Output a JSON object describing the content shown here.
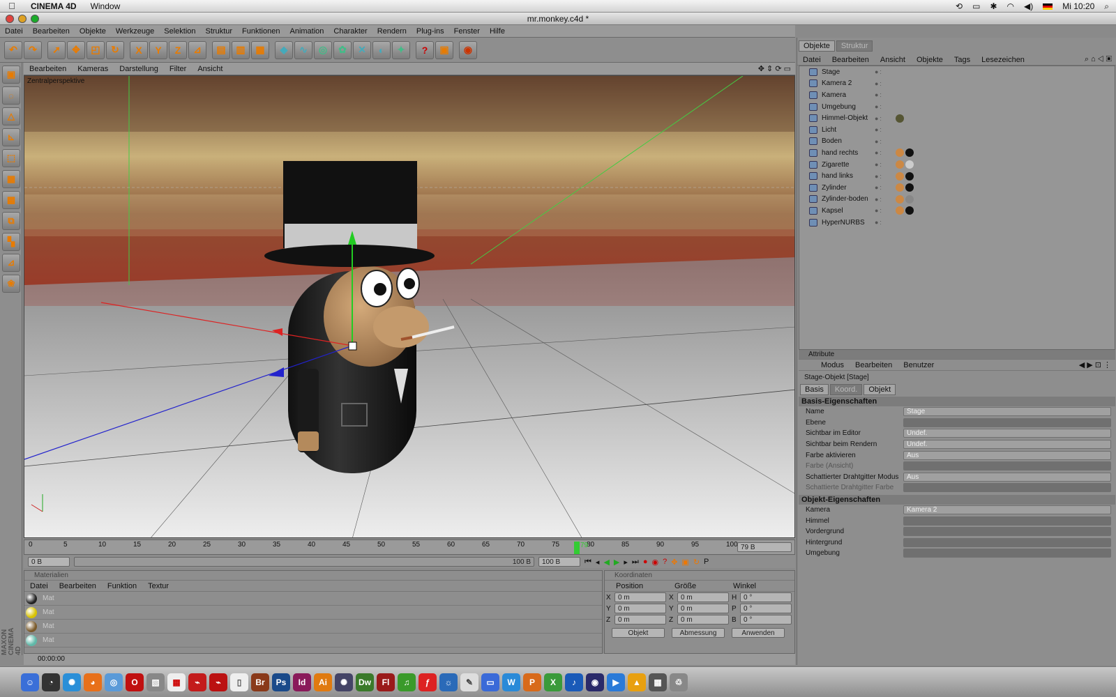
{
  "menubar": {
    "app": "CINEMA 4D",
    "window": "Window",
    "clock": "Mi 10:20"
  },
  "window": {
    "title": "mr.monkey.c4d *"
  },
  "main_menu": [
    "Datei",
    "Bearbeiten",
    "Objekte",
    "Werkzeuge",
    "Selektion",
    "Struktur",
    "Funktionen",
    "Animation",
    "Charakter",
    "Rendern",
    "Plug-ins",
    "Fenster",
    "Hilfe"
  ],
  "toolbar": {
    "axis_x": "X",
    "axis_y": "Y",
    "axis_z": "Z"
  },
  "viewport": {
    "menu": [
      "Bearbeiten",
      "Kameras",
      "Darstellung",
      "Filter",
      "Ansicht"
    ],
    "label": "Zentralperspektive"
  },
  "timeline": {
    "ticks": [
      "0",
      "5",
      "10",
      "15",
      "20",
      "25",
      "30",
      "35",
      "40",
      "45",
      "50",
      "55",
      "60",
      "65",
      "70",
      "75",
      "80",
      "85",
      "90",
      "95",
      "100"
    ],
    "current": "79",
    "current_field": "79 B",
    "start": "0 B",
    "range_end": "100 B",
    "end_field": "100 B"
  },
  "materials": {
    "title": "Materialien",
    "menu": [
      "Datei",
      "Bearbeiten",
      "Funktion",
      "Textur"
    ],
    "items": [
      {
        "name": "Mat",
        "color": "#222"
      },
      {
        "name": "Mat",
        "color": "#d8c200"
      },
      {
        "name": "Mat",
        "color": "#7a5a2a"
      },
      {
        "name": "Mat",
        "color": "#5fb8a8"
      }
    ]
  },
  "coords": {
    "title": "Koordinaten",
    "col_position": "Position",
    "col_size": "Größe",
    "col_angle": "Winkel",
    "rows": [
      {
        "a": "X",
        "p": "0 m",
        "b": "X",
        "s": "0 m",
        "c": "H",
        "w": "0 °"
      },
      {
        "a": "Y",
        "p": "0 m",
        "b": "Y",
        "s": "0 m",
        "c": "P",
        "w": "0 °"
      },
      {
        "a": "Z",
        "p": "0 m",
        "b": "Z",
        "s": "0 m",
        "c": "B",
        "w": "0 °"
      }
    ],
    "mode": "Objekt",
    "measure": "Abmessung",
    "apply": "Anwenden"
  },
  "status": {
    "time": "00:00:00"
  },
  "objects": {
    "tab_objects": "Objekte",
    "tab_structure": "Struktur",
    "menu": [
      "Datei",
      "Bearbeiten",
      "Ansicht",
      "Objekte",
      "Tags",
      "Lesezeichen"
    ],
    "items": [
      "Stage",
      "Kamera 2",
      "Kamera",
      "Umgebung",
      "Himmel-Objekt",
      "Licht",
      "Boden",
      "hand rechts",
      "Zigarette",
      "hand links",
      "Zylinder",
      "Zylinder-boden",
      "Kapsel",
      "HyperNURBS"
    ]
  },
  "attributes": {
    "title": "Attribute",
    "menu": [
      "Modus",
      "Bearbeiten",
      "Benutzer"
    ],
    "object": "Stage-Objekt [Stage]",
    "tabs": [
      "Basis",
      "Koord.",
      "Objekt"
    ],
    "basic_title": "Basis-Eigenschaften",
    "basic": [
      {
        "label": "Name",
        "value": "Stage"
      },
      {
        "label": "Ebene",
        "value": ""
      },
      {
        "label": "Sichtbar im Editor",
        "value": "Undef."
      },
      {
        "label": "Sichtbar beim Rendern",
        "value": "Undef."
      },
      {
        "label": "Farbe aktivieren",
        "value": "Aus"
      },
      {
        "label": "Farbe (Ansicht)",
        "value": ""
      },
      {
        "label": "Schattierter Drahtgitter Modus",
        "value": "Aus"
      },
      {
        "label": "Schattierte Drahtgitter Farbe",
        "value": ""
      }
    ],
    "object_title": "Objekt-Eigenschaften",
    "object_props": [
      {
        "label": "Kamera",
        "value": "Kamera 2"
      },
      {
        "label": "Himmel",
        "value": ""
      },
      {
        "label": "Vordergrund",
        "value": ""
      },
      {
        "label": "Hintergrund",
        "value": ""
      },
      {
        "label": "Umgebung",
        "value": ""
      }
    ]
  },
  "dock": [
    "Br",
    "Ps",
    "Id",
    "Ai",
    "Dw",
    "Fl"
  ],
  "logo": "MAXON CINEMA 4D"
}
